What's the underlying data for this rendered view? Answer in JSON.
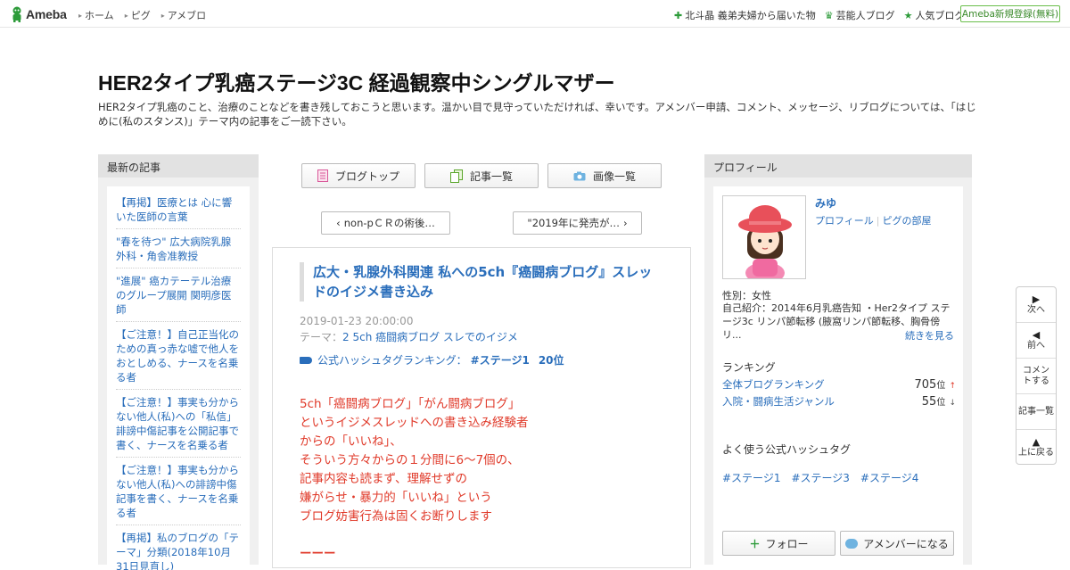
{
  "topbar": {
    "logo_text": "Ameba",
    "nav": [
      "ホーム",
      "ピグ",
      "アメブロ"
    ],
    "links": [
      "北斗晶 義弟夫婦から届いた物",
      "芸能人ブログ",
      "人気ブログ"
    ],
    "register_label": "Ameba新規登録(無料)"
  },
  "blog": {
    "title": "HER2タイプ乳癌ステージ3C 経過観察中シングルマザー",
    "description": "HER2タイプ乳癌のこと、治療のことなどを書き残しておこうと思います。温かい目で見守っていただければ、幸いです。アメンバー申請、コメント、メッセージ、リブログについては、「はじめに(私のスタンス)」テーマ内の記事をご一読下さい。"
  },
  "left_sidebar": {
    "heading": "最新の記事",
    "items": [
      "【再掲】医療とは 心に響いた医師の言葉",
      "\"春を待つ\" 広大病院乳腺外科・角舎准教授",
      "\"進展\" 癌カテーテル治療のグループ展開 関明彦医師",
      "【ご注意！】自己正当化のための真っ赤な嘘で他人をおとしめる、ナースを名乗る者",
      "【ご注意！】事実も分からない他人(私)への「私信」誹謗中傷記事を公開記事で書く、ナースを名乗る者",
      "【ご注意！】事実も分からない他人(私)への誹謗中傷記事を書く、ナースを名乗る者",
      "【再掲】私のブログの「テーマ」分類(2018年10月31日見直し)"
    ]
  },
  "toolbar": {
    "top_label": "ブログトップ",
    "list_label": "記事一覧",
    "image_label": "画像一覧"
  },
  "pager": {
    "prev_label": "non-pＣＲの術後…",
    "next_label": "\"2019年に発売が…"
  },
  "article": {
    "title": "広大・乳腺外科関連 私への5ch『癌闘病ブログ』スレッドのイジメ書き込み",
    "date": "2019-01-23 20:00:00",
    "theme_prefix": "テーマ：",
    "theme": "2 5ch 癌闘病ブログ スレでのイジメ",
    "ranking_text": "公式ハッシュタグランキング：",
    "ranking_tag": "#ステージ1",
    "ranking_pos": "20位",
    "body_lines": [
      "5ch「癌闘病ブログ」「がん闘病ブログ」",
      "というイジメスレッドへの書き込み経験者",
      "からの「いいね」、",
      "そういう方々からの１分間に6～7個の、",
      "記事内容も読まず、理解せずの",
      "嫌がらせ・暴力的「いいね」という",
      "ブログ妨害行為は固くお断りします",
      "",
      "ーーー"
    ]
  },
  "profile": {
    "heading": "プロフィール",
    "name": "みゆ",
    "link_profile": "プロフィール",
    "link_pigg": "ピグの部屋",
    "gender": "性別：女性",
    "intro": "自己紹介：2014年6月乳癌告知 ・Her2タイプ ステージ3c リンパ節転移 (腋窩リンパ節転移、胸骨傍リ...",
    "more_label": "続きを見る",
    "ranking_heading": "ランキング",
    "rankings": [
      {
        "label": "全体ブログランキング",
        "value": "705",
        "unit": "位",
        "trend": "↑"
      },
      {
        "label": "入院・闘病生活ジャンル",
        "value": "55",
        "unit": "位",
        "trend": "↓"
      }
    ],
    "hashtag_heading": "よく使う公式ハッシュタグ",
    "hashtags": [
      "#ステージ1",
      "#ステージ3",
      "#ステージ4"
    ],
    "follow_label": "フォロー",
    "amember_label": "アメンバーになる"
  },
  "side_nav": {
    "next_label": "次へ",
    "prev_label": "前へ",
    "comment_label": "コメントする",
    "list_label": "記事一覧",
    "top_label": "上に戻る"
  },
  "colors": {
    "accent_green": "#2d9b3a",
    "link_blue": "#2a6ebb",
    "body_red": "#e03a2a"
  }
}
